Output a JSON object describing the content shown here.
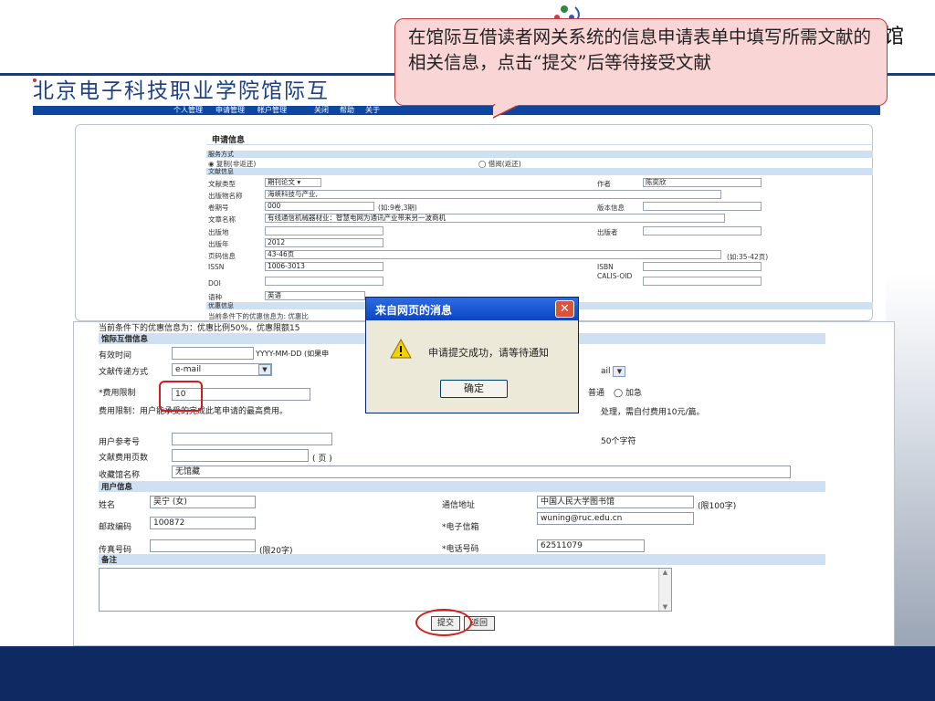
{
  "slide": {
    "callout_text": "在馆际互借读者网关系统的信息申请表单中填写所需文献的相关信息，点击“提交”后等待接受文献",
    "logo_right_char": "馆"
  },
  "site": {
    "title": "北京电子科技职业学院馆际互",
    "nav": [
      "个人管理",
      "申请管理",
      "帐户管理",
      "关闭",
      "帮助",
      "关于"
    ]
  },
  "form_top": {
    "section_title": "申请信息",
    "service_header": "服务方式",
    "service_copy": "◉ 复制(非返还)",
    "service_loan": "◯ 借阅(返还)",
    "doc_header": "文献信息",
    "rows": {
      "doc_type_label": "文献类型",
      "doc_type_value": "期刊论文",
      "author_label": "作者",
      "author_value": "陈奕欣",
      "pub_name_label": "出版物名称",
      "pub_name_value": "海峡科技与产业,",
      "volume_label": "卷期号",
      "volume_value": "000",
      "volume_hint": "(如:9卷,3期)",
      "edition_label": "版本信息",
      "article_label": "文章名称",
      "article_value": "有线通信机械器材业：智慧电网为通讯产业带来另一波商机",
      "place_label": "出版地",
      "publisher_label": "出版者",
      "year_label": "出版年",
      "year_value": "2012",
      "pages_label": "页码信息",
      "pages_value": "43-46页",
      "pages_hint": "(如:35-42页)",
      "issn_label": "ISSN",
      "issn_value": "1006-3013",
      "isbn_label": "ISBN",
      "doi_label": "DOI",
      "calis_label": "CALIS-OID",
      "lang_label": "语种",
      "lang_value": "英语",
      "discount_header": "优惠信息",
      "discount_text": "当前条件下的优惠信息为: 优惠比"
    }
  },
  "form_bottom": {
    "discount_line": "当前条件下的优惠信息为：优惠比例50%，优惠限额15",
    "ill_header": "馆际互借信息",
    "valid_label": "有效时间",
    "valid_hint": "YYYY-MM-DD (如果申",
    "delivery_label": "文献传递方式",
    "delivery_value": "e-mail",
    "delivery_value2": "ail",
    "fee_label": "*费用限制",
    "fee_value": "10",
    "priority_normal": "普通",
    "priority_urgent": "加急",
    "fee_note": "费用限制：用户能承受的完成此笔申请的最高费用。",
    "fee_note_right": "处理，需自付费用10元/篇。",
    "ref_label": "用户参考号",
    "ref_note": "50个字符",
    "pages_label": "文献费用页数",
    "pages_unit": "( 页 )",
    "holding_label": "收藏馆名称",
    "holding_value": "无馆藏",
    "user_header": "用户信息",
    "name_label": "姓名",
    "name_value": "吴宁 (女)",
    "address_label": "通信地址",
    "address_value": "中国人民大学图书馆",
    "address_limit": "(限100字)",
    "zip_label": "邮政编码",
    "zip_value": "100872",
    "email_label": "*电子信箱",
    "email_value": "wuning@ruc.edu.cn",
    "fax_label": "传真号码",
    "fax_limit": "(限20字)",
    "phone_label": "*电话号码",
    "phone_value": "62511079",
    "remarks_header": "备注",
    "submit_label": "提交",
    "back_label": "返回"
  },
  "dialog": {
    "title": "来自网页的消息",
    "message": "申请提交成功，请等待通知",
    "ok_label": "确定",
    "close_glyph": "✕"
  }
}
